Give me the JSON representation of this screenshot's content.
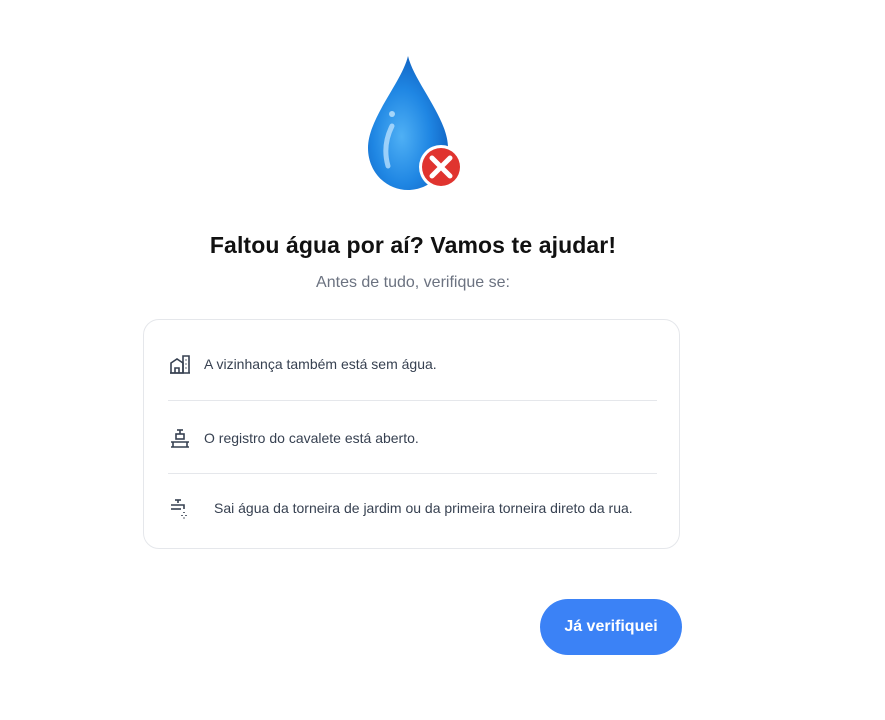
{
  "header": {
    "illustration": "water-drop-with-red-x-icon",
    "title": "Faltou água por aí? Vamos te ajudar!",
    "subtitle": "Antes de tudo, verifique se:"
  },
  "checklist": {
    "items": [
      {
        "icon": "neighborhood-buildings-icon",
        "label": "A vizinhança também está sem água."
      },
      {
        "icon": "water-meter-valve-icon",
        "label": "O registro do cavalete está aberto."
      },
      {
        "icon": "garden-faucet-icon",
        "label": "Sai água da torneira de jardim ou da primeira torneira direto da rua."
      }
    ]
  },
  "actions": {
    "confirm_label": "Já verifiquei"
  },
  "colors": {
    "primary": "#3b82f6",
    "drop_blue": "#1e88e5",
    "error_red": "#e53935",
    "muted_text": "#6b7280",
    "border": "#e5e7eb"
  }
}
